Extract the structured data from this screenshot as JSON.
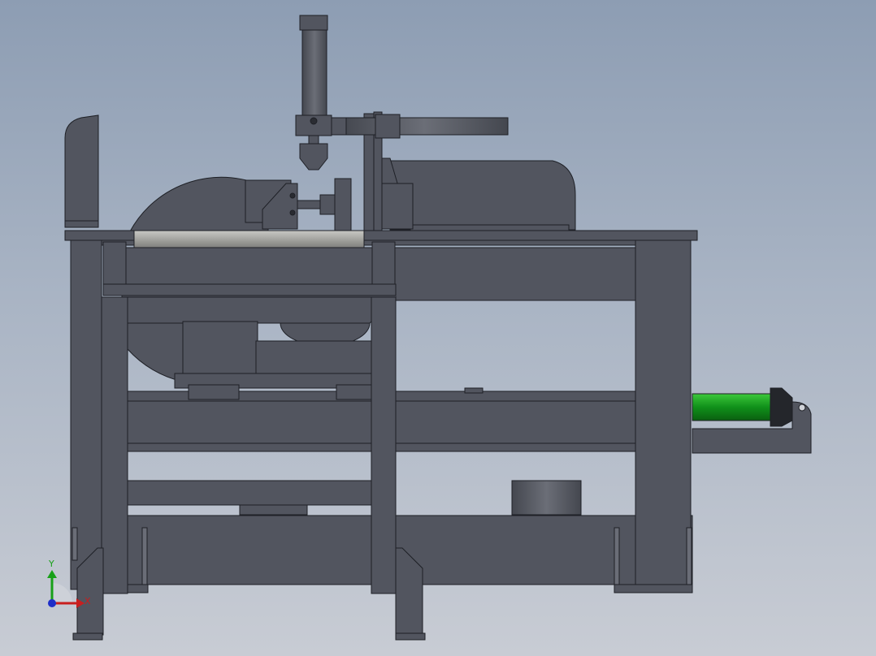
{
  "viewport": {
    "background_top": "#8d9db3",
    "background_bottom": "#c8ccd4"
  },
  "model": {
    "body_color": "#52555f",
    "edge_color": "#1e2026",
    "roller_color": "#a3a3a0",
    "cylinder_rod_color": "#1aa01a"
  },
  "triad": {
    "y_label": "Y",
    "x_label": "X",
    "y_color": "#18a018",
    "x_color": "#c81e1e",
    "z_color": "#1e2ec8"
  }
}
